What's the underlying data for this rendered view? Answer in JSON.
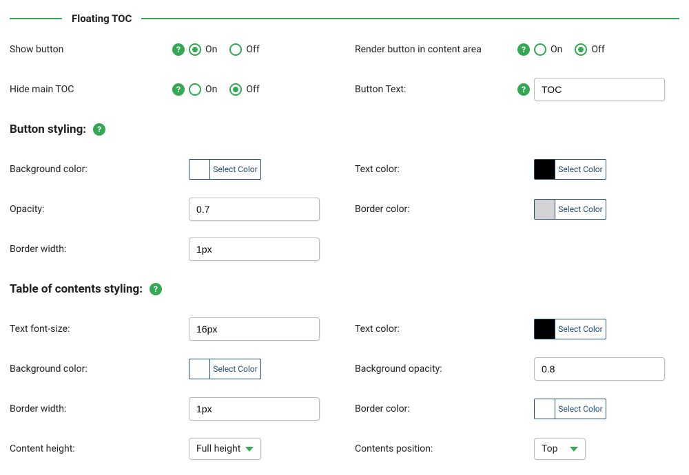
{
  "section_title": "Floating TOC",
  "common": {
    "on": "On",
    "off": "Off",
    "select_color": "Select Color",
    "help": "?"
  },
  "rows": {
    "show_button": {
      "label": "Show button",
      "value": "on"
    },
    "render_in_content": {
      "label": "Render button in content area",
      "value": "off"
    },
    "hide_main_toc": {
      "label": "Hide main TOC",
      "value": "off"
    },
    "button_text": {
      "label": "Button Text:",
      "value": "TOC"
    }
  },
  "button_styling": {
    "heading": "Button styling:",
    "bg_color": {
      "label": "Background color:",
      "swatch": "#ffffff"
    },
    "text_color": {
      "label": "Text color:",
      "swatch": "#000000"
    },
    "opacity": {
      "label": "Opacity:",
      "value": "0.7"
    },
    "border_color": {
      "label": "Border color:",
      "swatch": "#d4d4d4"
    },
    "border_width": {
      "label": "Border width:",
      "value": "1px"
    }
  },
  "toc_styling": {
    "heading": "Table of contents styling:",
    "font_size": {
      "label": "Text font-size:",
      "value": "16px"
    },
    "text_color": {
      "label": "Text color:",
      "swatch": "#000000"
    },
    "bg_color": {
      "label": "Background color:",
      "swatch": "#ffffff"
    },
    "bg_opacity": {
      "label": "Background opacity:",
      "value": "0.8"
    },
    "border_width": {
      "label": "Border width:",
      "value": "1px"
    },
    "border_color": {
      "label": "Border color:",
      "swatch": "#ffffff"
    },
    "content_height": {
      "label": "Content height:",
      "value": "Full height"
    },
    "contents_position": {
      "label": "Contents position:",
      "value": "Top"
    }
  }
}
